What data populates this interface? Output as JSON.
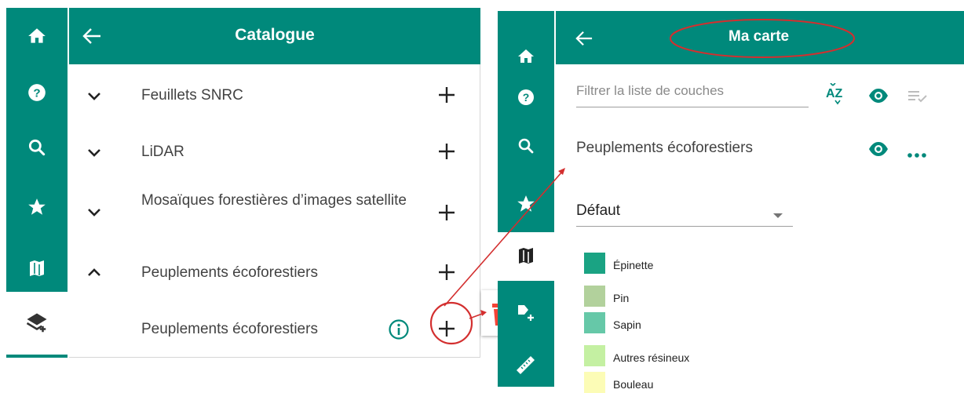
{
  "left_panel": {
    "rail": {
      "items": [
        {
          "icon": "home-icon"
        },
        {
          "icon": "help-icon"
        },
        {
          "icon": "search-icon"
        },
        {
          "icon": "star-icon"
        },
        {
          "icon": "map-icon"
        },
        {
          "icon": "layers-add-icon",
          "active": true
        }
      ]
    },
    "header": {
      "back_icon": "arrow-left-icon",
      "title": "Catalogue"
    },
    "items": [
      {
        "label": "Feuillets SNRC",
        "expand": "chevron-down-icon"
      },
      {
        "label": "LiDAR",
        "expand": "chevron-down-icon"
      },
      {
        "label": "Mosaïques forestières d’images satellite",
        "expand": "chevron-down-icon"
      },
      {
        "label": "Peuplements écoforestiers",
        "expand": "chevron-up-icon"
      },
      {
        "label": "Peuplements écoforestiers",
        "child": true,
        "info_icon": "info-icon"
      }
    ]
  },
  "right_panel": {
    "rail": {
      "items": [
        {
          "icon": "home-icon"
        },
        {
          "icon": "help-icon"
        },
        {
          "icon": "search-icon"
        },
        {
          "icon": "star-icon"
        },
        {
          "icon": "map-icon",
          "active": true
        },
        {
          "icon": "layer-export-icon"
        },
        {
          "icon": "ruler-icon"
        }
      ]
    },
    "header": {
      "back_icon": "arrow-left-icon",
      "title": "Ma carte"
    },
    "filter": {
      "placeholder": "Filtrer la liste de couches"
    },
    "layer": {
      "name": "Peuplements écoforestiers"
    },
    "style_select": {
      "value": "Défaut"
    },
    "legend": [
      {
        "label": "Épinette",
        "color": "#1aa383"
      },
      {
        "label": "Pin",
        "color": "#b2d19c"
      },
      {
        "label": "Sapin",
        "color": "#66c8a8"
      },
      {
        "label": "Autres résineux",
        "color": "#c4f0a2"
      },
      {
        "label": "Bouleau",
        "color": "#fcfcb6"
      }
    ]
  },
  "colors": {
    "primary": "#00897b",
    "annotation": "#e53935",
    "delete": "#f44336"
  }
}
